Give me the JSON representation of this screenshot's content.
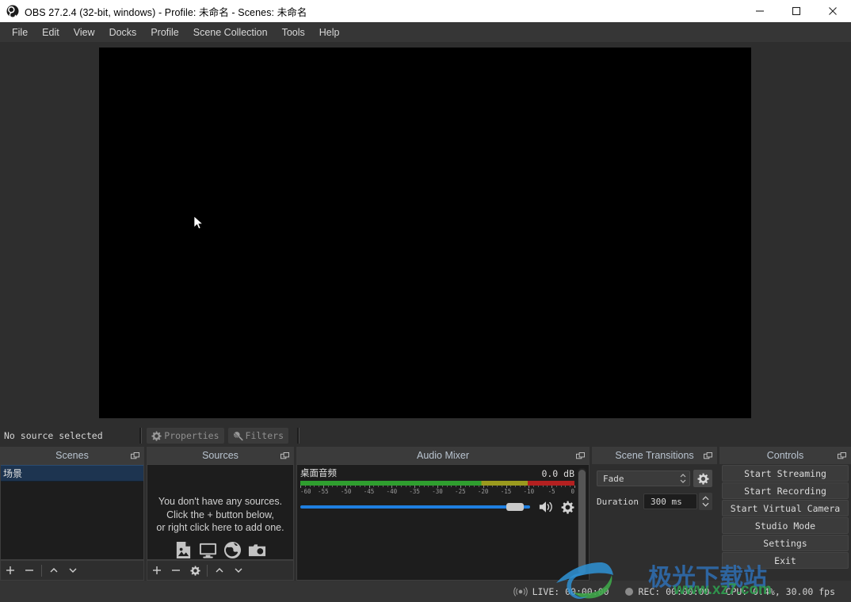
{
  "window": {
    "title": "OBS 27.2.4 (32-bit, windows) - Profile: 未命名 - Scenes: 未命名",
    "logo_icon": "obs-logo-icon",
    "minimize_icon": "minimize-icon",
    "maximize_icon": "maximize-icon",
    "close_icon": "close-icon"
  },
  "menubar": {
    "items": [
      {
        "label": "File"
      },
      {
        "label": "Edit"
      },
      {
        "label": "View"
      },
      {
        "label": "Docks"
      },
      {
        "label": "Profile"
      },
      {
        "label": "Scene Collection"
      },
      {
        "label": "Tools"
      },
      {
        "label": "Help"
      }
    ]
  },
  "preview": {
    "canvas_color": "#000000",
    "cursor_icon": "mouse-pointer-icon"
  },
  "source_bar": {
    "status": "No source selected",
    "properties_label": "Properties",
    "properties_icon": "gear-icon",
    "filters_label": "Filters",
    "filters_icon": "magic-wand-icon"
  },
  "scenes": {
    "title": "Scenes",
    "float_icon": "float-dock-icon",
    "items": [
      {
        "label": "场景",
        "selected": true
      }
    ],
    "toolbar": [
      {
        "icon": "plus-icon",
        "name": "add-scene"
      },
      {
        "icon": "minus-icon",
        "name": "remove-scene"
      },
      {
        "icon": "chevron-up-icon",
        "name": "move-scene-up"
      },
      {
        "icon": "chevron-down-icon",
        "name": "move-scene-down"
      }
    ]
  },
  "sources": {
    "title": "Sources",
    "float_icon": "float-dock-icon",
    "empty_lines": [
      "You don't have any sources.",
      "Click the + button below,",
      "or right click here to add one."
    ],
    "empty_icons": [
      "image-file-icon",
      "display-monitor-icon",
      "globe-browser-icon",
      "camera-icon"
    ],
    "toolbar": [
      {
        "icon": "plus-icon",
        "name": "add-source"
      },
      {
        "icon": "minus-icon",
        "name": "remove-source"
      },
      {
        "icon": "gear-icon",
        "name": "source-properties"
      },
      {
        "icon": "chevron-up-icon",
        "name": "move-source-up"
      },
      {
        "icon": "chevron-down-icon",
        "name": "move-source-down"
      }
    ]
  },
  "audio_mixer": {
    "title": "Audio Mixer",
    "float_icon": "float-dock-icon",
    "channel_name": "桌面音频",
    "level_db": "0.0  dB",
    "scale_ticks": [
      "-60",
      "-55",
      "-50",
      "-45",
      "-40",
      "-35",
      "-30",
      "-25",
      "-20",
      "-15",
      "-10",
      "-5",
      "0"
    ],
    "volume_percent": 95,
    "meter_green_end_pct": 66,
    "meter_yellow_end_pct": 83,
    "mute_icon": "speaker-icon",
    "settings_icon": "gear-icon",
    "meter_colors": {
      "green": "#2f9e2f",
      "yellow": "#9a9a1e",
      "red": "#b32020",
      "slider": "#1f7fe0"
    }
  },
  "scene_transitions": {
    "title": "Scene Transitions",
    "float_icon": "float-dock-icon",
    "transition_value": "Fade",
    "transition_spin_icon": "spinner-updown-icon",
    "config_icon": "gear-icon",
    "duration_label": "Duration",
    "duration_value": "300 ms",
    "duration_spin_up_icon": "chevron-up-icon",
    "duration_spin_down_icon": "chevron-down-icon"
  },
  "controls": {
    "title": "Controls",
    "float_icon": "float-dock-icon",
    "buttons": [
      {
        "label": "Start Streaming",
        "name": "start-streaming-button"
      },
      {
        "label": "Start Recording",
        "name": "start-recording-button"
      },
      {
        "label": "Start Virtual Camera",
        "name": "start-virtual-camera-button"
      },
      {
        "label": "Studio Mode",
        "name": "studio-mode-button"
      },
      {
        "label": "Settings",
        "name": "settings-button"
      },
      {
        "label": "Exit",
        "name": "exit-button"
      }
    ]
  },
  "statusbar": {
    "live_icon": "broadcast-icon",
    "live": "LIVE: 00:00:00",
    "rec_icon": "record-dot-icon",
    "rec": "REC: 00:00:00",
    "cpu": "CPU: 0.4%, 30.00 fps"
  },
  "watermark": {
    "text": "极光下载站",
    "url": "www.xz7.com",
    "logo_icon": "watermark-logo-icon"
  }
}
